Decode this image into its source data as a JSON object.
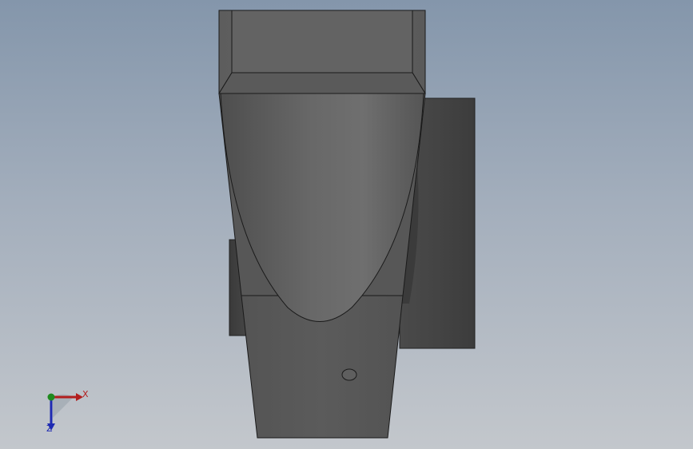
{
  "viewport": {
    "background_top": "#8496ab",
    "background_bottom": "#c3c7cc",
    "model_color": "#555555"
  },
  "triad": {
    "x_label": "X",
    "z_label": "Z",
    "x_color": "#b21e1e",
    "y_color": "#1e8a1e",
    "z_color": "#1e2ab2"
  }
}
